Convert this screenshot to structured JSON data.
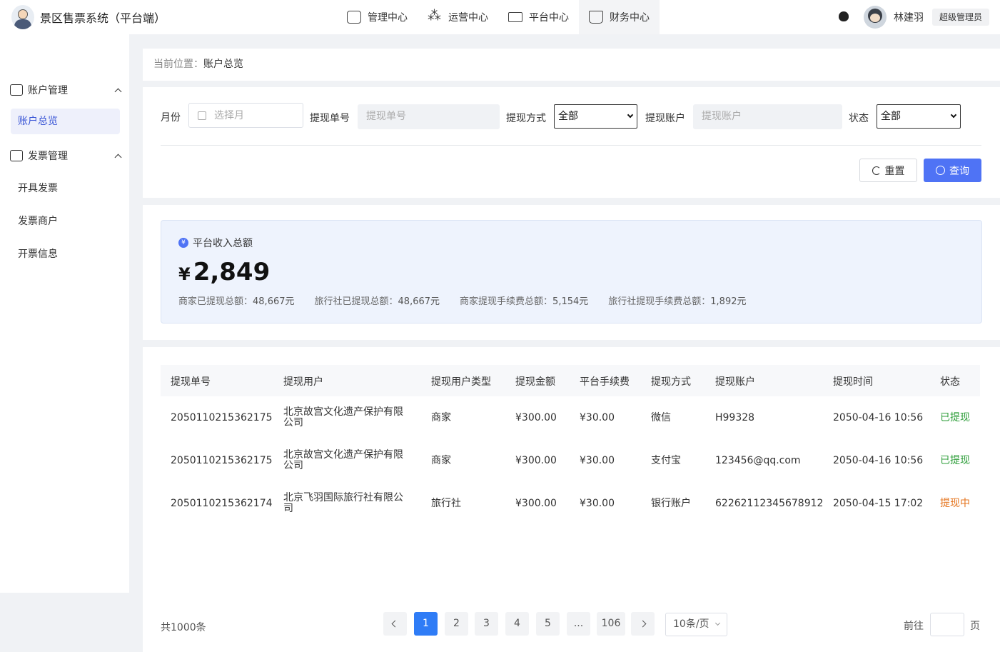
{
  "header": {
    "app_title": "景区售票系统（平台端）",
    "nav": [
      {
        "label": "管理中心",
        "icon": "management-icon"
      },
      {
        "label": "运营中心",
        "icon": "operations-icon"
      },
      {
        "label": "平台中心",
        "icon": "platform-icon"
      },
      {
        "label": "财务中心",
        "icon": "finance-icon",
        "active": true
      }
    ],
    "username": "林建羽",
    "role": "超级管理员"
  },
  "sidebar": {
    "groups": [
      {
        "label": "账户管理",
        "items": [
          "账户总览"
        ]
      },
      {
        "label": "发票管理",
        "items": [
          "开具发票",
          "发票商户",
          "开票信息"
        ]
      }
    ],
    "active_item": "账户总览"
  },
  "breadcrumb": {
    "prefix": "当前位置：",
    "current": "账户总览"
  },
  "filters": {
    "month_label": "月份",
    "month_placeholder": "选择月",
    "order_no_label": "提现单号",
    "order_no_placeholder": "提现单号",
    "method_label": "提现方式",
    "method_value": "全部",
    "account_label": "提现账户",
    "account_placeholder": "提现账户",
    "status_label": "状态",
    "status_value": "全部",
    "reset_label": "重置",
    "query_label": "查询"
  },
  "summary": {
    "title": "平台收入总额",
    "currency": "¥",
    "total": "2,849",
    "stats": [
      {
        "label": "商家已提现总额：",
        "value": "48,667元"
      },
      {
        "label": "旅行社已提现总额：",
        "value": "48,667元"
      },
      {
        "label": "商家提现手续费总额：",
        "value": "5,154元"
      },
      {
        "label": "旅行社提现手续费总额：",
        "value": "1,892元"
      }
    ]
  },
  "table": {
    "columns": [
      "提现单号",
      "提现用户",
      "提现用户类型",
      "提现金额",
      "平台手续费",
      "提现方式",
      "提现账户",
      "提现时间",
      "状态"
    ],
    "rows": [
      {
        "order_no": "2050110215362175",
        "user": "北京故宫文化遗产保护有限公司",
        "user_type": "商家",
        "amount": "¥300.00",
        "fee": "¥30.00",
        "method": "微信",
        "account": "H99328",
        "time": "2050-04-16 10:56",
        "status": "已提现"
      },
      {
        "order_no": "2050110215362175",
        "user": "北京故宫文化遗产保护有限公司",
        "user_type": "商家",
        "amount": "¥300.00",
        "fee": "¥30.00",
        "method": "支付宝",
        "account": "123456@qq.com",
        "time": "2050-04-16 10:56",
        "status": "已提现"
      },
      {
        "order_no": "2050110215362174",
        "user": "北京飞羽国际旅行社有限公司",
        "user_type": "旅行社",
        "amount": "¥300.00",
        "fee": "¥30.00",
        "method": "银行账户",
        "account": "62262112345678912",
        "time": "2050-04-15 17:02",
        "status": "提现中"
      }
    ]
  },
  "pagination": {
    "total": "共1000条",
    "pages": [
      "1",
      "2",
      "3",
      "4",
      "5",
      "...",
      "106"
    ],
    "current": "1",
    "page_size": "10条/页",
    "goto_label": "前往",
    "goto_suffix": "页"
  },
  "colors": {
    "primary": "#4f73f5",
    "status_done": "#2e9e3a",
    "status_pending": "#e5751f"
  }
}
